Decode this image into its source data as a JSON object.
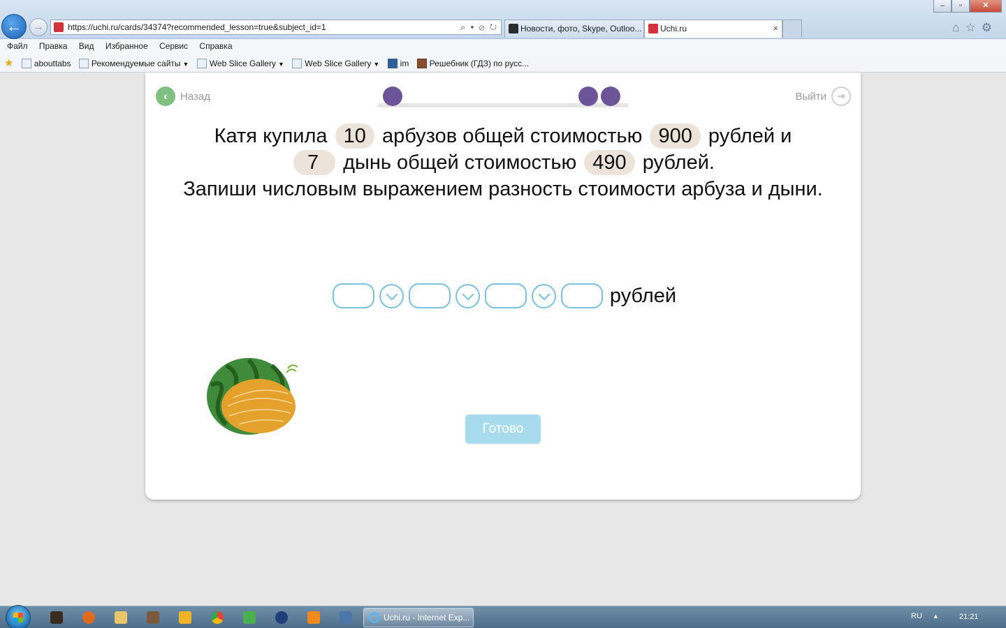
{
  "browser": {
    "url": "https://uchi.ru/cards/34374?recommended_lesson=true&subject_id=1",
    "tabs": [
      {
        "title": "Новости, фото, Skype, Outloo..."
      },
      {
        "title": "Uchi.ru"
      }
    ],
    "close_tab": "×",
    "menu": [
      "Файл",
      "Правка",
      "Вид",
      "Избранное",
      "Сервис",
      "Справка"
    ],
    "favorites": [
      "abouttabs",
      "Рекомендуемые сайты",
      "Web Slice Gallery",
      "Web Slice Gallery",
      "im",
      "Решебник (ГДЗ) по русс..."
    ]
  },
  "lesson": {
    "back_label": "Назад",
    "exit_label": "Выйти",
    "progress": {
      "total_dots": 3,
      "completed_dots": 3
    },
    "task": {
      "line1_a": "Катя купила",
      "watermelon_count": "10",
      "line1_b": "арбузов общей стоимостью",
      "watermelon_cost": "900",
      "line1_c": "рублей и",
      "melon_count": "7",
      "line2_b": "дынь общей стоимостью",
      "melon_cost": "490",
      "line2_c": "рублей.",
      "instruction": "Запиши числовым выражением разность стоимости арбуза и дыни."
    },
    "answer": {
      "slots": [
        "",
        "",
        "",
        ""
      ],
      "operator_count": 3,
      "unit": "рублей"
    },
    "done_label": "Готово"
  },
  "taskbar": {
    "active_window": "Uchi.ru - Internet Exp...",
    "lang": "RU",
    "time": "21:21"
  },
  "colors": {
    "accent_purple": "#6b5497",
    "input_border": "#7ac0de",
    "pill_bg": "#ece3da",
    "done_button": "#a9dbee",
    "back_green": "#7fbf7f"
  }
}
